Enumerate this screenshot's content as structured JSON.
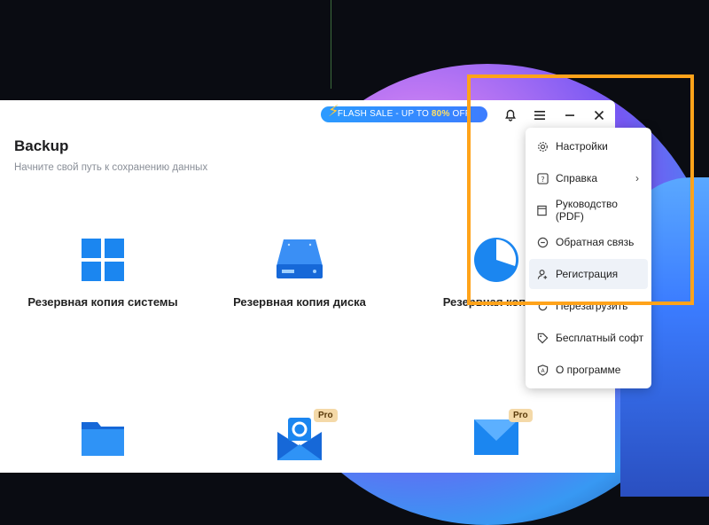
{
  "window": {
    "flash_sale_prefix": "FLASH SALE - UP TO ",
    "flash_sale_percent": "80%",
    "flash_sale_suffix": " OFF",
    "page_title": "Backup",
    "page_subtitle": "Начните свой путь к сохранению данных"
  },
  "tiles": [
    {
      "label": "Резервная копия системы",
      "icon": "windows-icon"
    },
    {
      "label": "Резервная копия диска",
      "icon": "disk-icon"
    },
    {
      "label": "Резервная копия р",
      "icon": "partition-pie-icon"
    },
    {
      "label": "",
      "icon": "folder-icon"
    },
    {
      "label": "",
      "icon": "outlook-icon",
      "badge": "Pro"
    },
    {
      "label": "",
      "icon": "mail-icon",
      "badge": "Pro"
    }
  ],
  "menu": {
    "items": [
      {
        "label": "Настройки",
        "icon": "gear-icon"
      },
      {
        "label": "Справка",
        "icon": "help-icon",
        "has_submenu": true
      },
      {
        "label": "Руководство (PDF)",
        "icon": "manual-icon"
      },
      {
        "label": "Обратная связь",
        "icon": "feedback-icon"
      },
      {
        "label": "Регистрация",
        "icon": "user-register-icon",
        "active": true
      },
      {
        "label": "Перезагрузить",
        "icon": "reload-icon"
      },
      {
        "label": "Бесплатный софт",
        "icon": "tag-icon"
      },
      {
        "label": "О программе",
        "icon": "about-icon"
      }
    ]
  },
  "colors": {
    "accent": "#1f7bea",
    "highlight": "#ffa31a",
    "flash_gradient": "#2b9bff"
  }
}
